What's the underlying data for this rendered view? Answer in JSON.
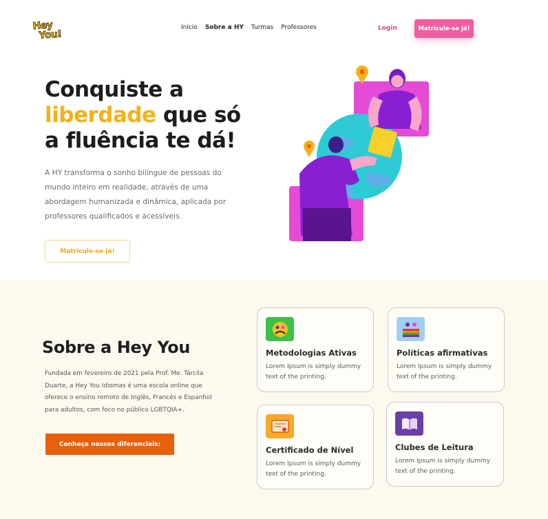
{
  "brand": {
    "logo_line1": "Hey",
    "logo_line2": "You!"
  },
  "nav": {
    "items": [
      "Início",
      "Sobre a HY",
      "Turmas",
      "Professores"
    ],
    "login": "Login",
    "cta": "Matricule-se já!"
  },
  "hero": {
    "title_part1": "Conquiste a",
    "title_highlight": "liberdade",
    "title_part2": "que só",
    "title_part3": "a fluência te dá!",
    "description": "A HY transforma o sonho bilíngue de pessoas do mundo inteiro em realidade, através de uma abordagem humanizada e dinâmica, aplicada por professores qualificados e acessíveis.",
    "button": "Matricule-se já!"
  },
  "about": {
    "title": "Sobre a Hey You",
    "description": "Fundada em fevereiro de 2021 pela Prof. Me. Tárcila Duarte, a Hey You Idiomas é uma escola online que oferece o ensino remoto de Inglês, Francês e Espanhol para adultos, com foco no público LGBTQIA+.",
    "button": "Conheça nossos diferenciais:",
    "cards": [
      {
        "icon": "active-methods-icon",
        "title": "Metodologias Ativas",
        "text": "Lorem Ipsum is simply dummy text of the printing."
      },
      {
        "icon": "affirmative-policies-icon",
        "title": "Políticas afirmativas",
        "text": "Lorem Ipsum is simply dummy text of the printing."
      },
      {
        "icon": "certificate-icon",
        "title": "Certificado de Nível",
        "text": "Lorem Ipsum is simply dummy text of the printing."
      },
      {
        "icon": "book-club-icon",
        "title": "Clubes de Leitura",
        "text": "Lorem Ipsum is simply dummy text of the printing."
      }
    ]
  },
  "colors": {
    "accent_yellow": "#f5b11a",
    "pink": "#f05da0",
    "orange": "#e8600c",
    "purple": "#8a1fd1",
    "cream": "#fdf9ef"
  }
}
